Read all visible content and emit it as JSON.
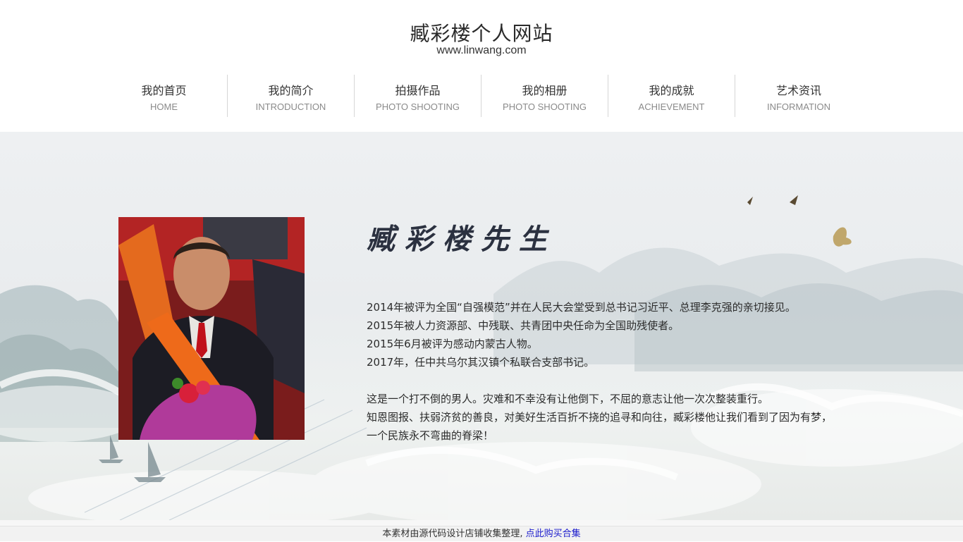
{
  "site": {
    "title": "臧彩楼个人网站",
    "url": "www.linwang.com"
  },
  "nav": [
    {
      "cn": "我的首页",
      "en": "HOME"
    },
    {
      "cn": "我的简介",
      "en": "INTRODUCTION"
    },
    {
      "cn": "拍摄作品",
      "en": "PHOTO SHOOTING"
    },
    {
      "cn": "我的相册",
      "en": "PHOTO SHOOTING"
    },
    {
      "cn": "我的成就",
      "en": "ACHIEVEMENT"
    },
    {
      "cn": "艺术资讯",
      "en": "INFORMATION"
    }
  ],
  "profile": {
    "name": "臧彩楼先生",
    "bio": [
      "2014年被评为全国“自强模范”并在人民大会堂受到总书记习近平、总理李克强的亲切接见。",
      "2015年被人力资源部、中残联、共青团中央任命为全国助残使者。",
      "2015年6月被评为感动内蒙古人物。",
      "2017年，任中共乌尔其汉镇个私联合支部书记。"
    ],
    "quote": [
      "这是一个打不倒的男人。灾难和不幸没有让他倒下，不屈的意志让他一次次整装重行。",
      "知恩图报、扶弱济贫的善良，对美好生活百折不挠的追寻和向往，臧彩楼他让我们看到了因为有梦，",
      "一个民族永不弯曲的脊梁！"
    ]
  },
  "footer": {
    "text": "本素材由源代码设计店铺收集整理,",
    "link": "点此购买合集"
  }
}
